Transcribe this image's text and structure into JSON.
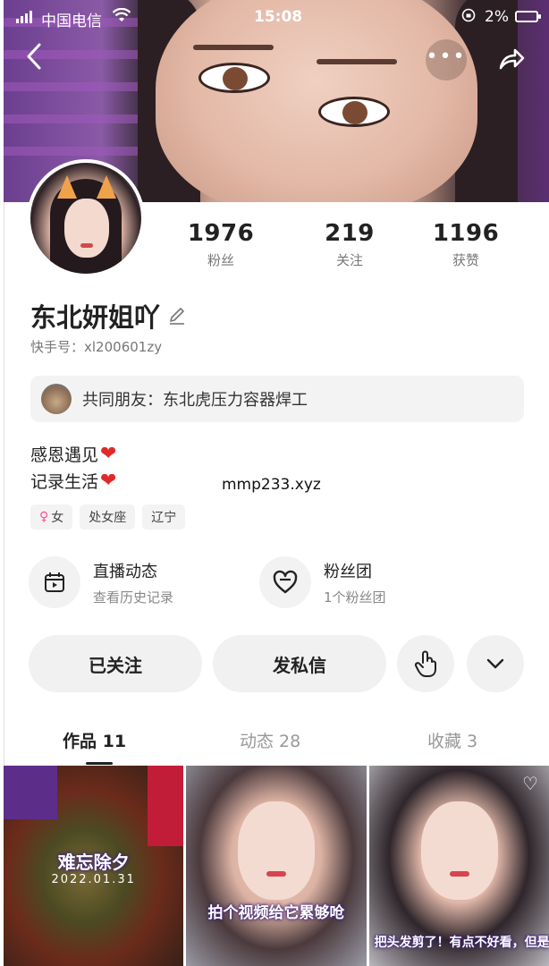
{
  "status": {
    "carrier": "中国电信",
    "time": "15:08",
    "battery": "2%"
  },
  "profile": {
    "name": "东北妍姐吖",
    "uid_label": "快手号：",
    "uid": "xl200601zy",
    "stats": [
      {
        "num": "1976",
        "label": "粉丝"
      },
      {
        "num": "219",
        "label": "关注"
      },
      {
        "num": "1196",
        "label": "获赞"
      }
    ],
    "mutual_friends": "共同朋友：东北虎压力容器焊工",
    "bio": [
      "感恩遇见",
      "记录生活"
    ],
    "bio_emoji": "❤",
    "tags": [
      "女",
      "处女座",
      "辽宁"
    ]
  },
  "watermark": "mmp233.xyz",
  "features": [
    {
      "title": "直播动态",
      "subtitle": "查看历史记录",
      "icon": "calendar-play-icon"
    },
    {
      "title": "粉丝团",
      "subtitle": "1个粉丝团",
      "icon": "heart-outline-icon"
    }
  ],
  "actions": {
    "follow_label": "已关注",
    "message_label": "发私信"
  },
  "tabs": [
    {
      "label": "作品 11",
      "active": true
    },
    {
      "label": "动态 28",
      "active": false
    },
    {
      "label": "收藏 3",
      "active": false
    }
  ],
  "works": [
    {
      "caption": "难忘除夕",
      "date": "2022.01.31"
    },
    {
      "caption": "拍个视频给它累够呛"
    },
    {
      "caption": "把头发剪了！有点不好看，但是我还是那个爱你们的小"
    }
  ],
  "colors": {
    "accent_pink": "#ff4f87",
    "heart_red": "#e02a2a"
  }
}
